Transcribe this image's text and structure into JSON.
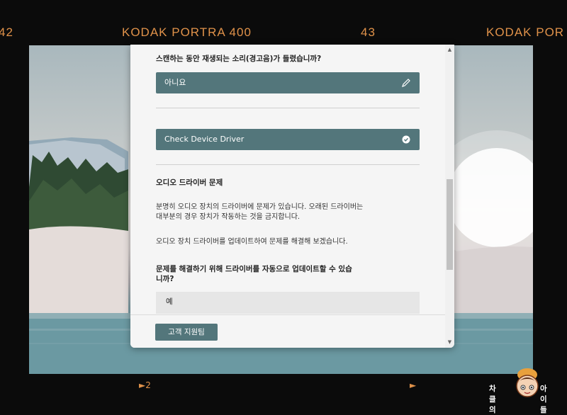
{
  "film": {
    "left_number": "42",
    "label_1": "KODAK PORTRA 400",
    "middle_number": "43",
    "label_2": "KODAK POR",
    "arrow_1": "►2",
    "arrow_2": "►"
  },
  "dialog": {
    "question_1": "스캔하는 동안 재생되는 소리(경고음)가 들렸습니까?",
    "answer_1": "아니요",
    "step_label": "Check Device Driver",
    "section_title": "오디오 드라이버 문제",
    "paragraph_1_line_1": "분명히 오디오 장치의 드라이버에 문제가 있습니다. 오래된 드라이버는",
    "paragraph_1_line_2": "대부분의 경우 장치가 작동하는 것을 금지합니다.",
    "paragraph_2": "오디오 장치 드라이버를 업데이트하여 문제를 해결해 보겠습니다.",
    "question_2_line_1": "문제를 해결하기 위해 드라이버를 자동으로 업데이트할 수 있습",
    "question_2_line_2": "니까?",
    "answer_2": "예",
    "support_button": "고객 지원팀"
  },
  "watermark": {
    "left": "차클의",
    "right": "아이들"
  },
  "colors": {
    "accent": "#53767b",
    "film_text": "#e0924a",
    "dialog_bg": "#f5f5f5"
  },
  "icons": {
    "edit": "pencil-icon",
    "done": "check-circle-icon"
  }
}
